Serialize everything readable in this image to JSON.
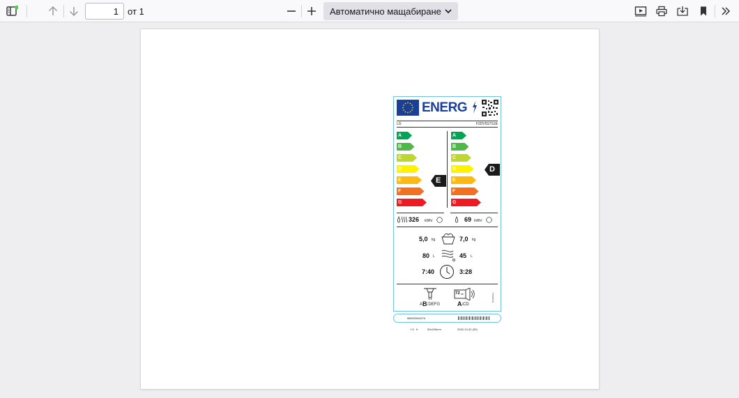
{
  "toolbar": {
    "page_number": "1",
    "page_total": "от 1",
    "zoom_value": "Автоматично мащабиране"
  },
  "label": {
    "energy_word": "ENERG",
    "brand": "LG",
    "model": "F2DV5S7S1E",
    "scale": [
      "A",
      "B",
      "C",
      "D",
      "E",
      "F",
      "G"
    ],
    "scale_colors": [
      "#00a651",
      "#50b848",
      "#bed630",
      "#fff200",
      "#fdb913",
      "#f37021",
      "#ed1c24"
    ],
    "class_left": "E",
    "class_right": "D",
    "energy_left": "326",
    "energy_left_unit": "kWh/",
    "energy_right": "69",
    "energy_right_unit": "kWh/",
    "capacity_wash": "5,0",
    "capacity_dry": "7,0",
    "capacity_unit": "kg",
    "water_left": "80",
    "water_right": "45",
    "water_unit": "L",
    "time_left": "7:40",
    "time_right": "3:28",
    "spin_classes": "ABCDEFG",
    "spin_class_big": "B",
    "noise_db": "72",
    "noise_unit": "dB",
    "noise_classes": "ABCD",
    "noise_class_big": "A",
    "regulation": "2019/2014",
    "footer_code": "MBZ63945275",
    "footer_color_c": "CM",
    "footer_color_k": "K",
    "footer_size": "90x190mm",
    "footer_date": "2020-10-02 (03)"
  }
}
